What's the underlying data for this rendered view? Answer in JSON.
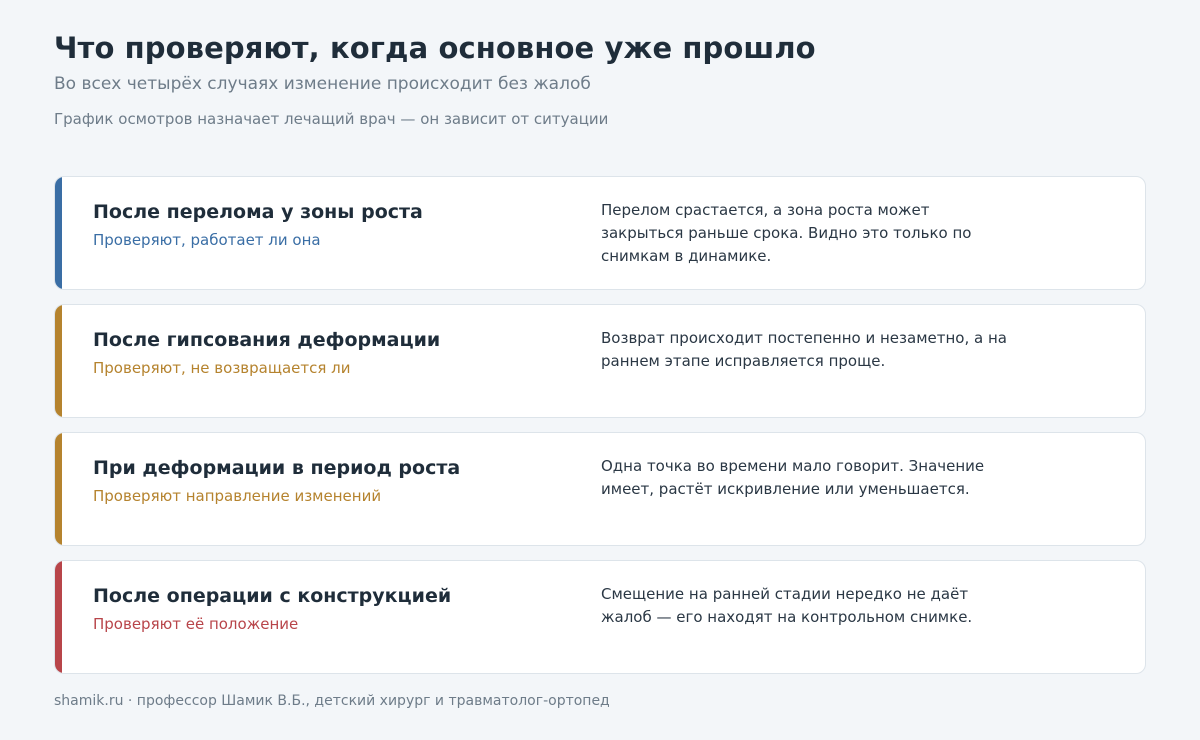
{
  "header": {
    "title": "Что проверяют, когда основное уже прошло",
    "subtitle": "Во всех четырёх случаях изменение происходит без жалоб",
    "note": "График осмотров назначает лечащий врач — он зависит от ситуации"
  },
  "colors": {
    "blue": "#3a6ea5",
    "amber": "#b5832e",
    "red": "#b8454a"
  },
  "cards": [
    {
      "heading": "После перелома у зоны роста",
      "sub": "Проверяют, работает ли она",
      "desc": "Перелом срастается, а зона роста может закрыться раньше срока. Видно это только по снимкам в динамике.",
      "accent": "#3a6ea5"
    },
    {
      "heading": "После гипсования деформации",
      "sub": "Проверяют, не возвращается ли",
      "desc": "Возврат происходит постепенно и незаметно, а на раннем этапе исправляется проще.",
      "accent": "#b5832e"
    },
    {
      "heading": "При деформации в период роста",
      "sub": "Проверяют направление изменений",
      "desc": "Одна точка во времени мало говорит. Значение имеет, растёт искривление или уменьшается.",
      "accent": "#b5832e"
    },
    {
      "heading": "После операции с конструкцией",
      "sub": "Проверяют её положение",
      "desc": "Смещение на ранней стадии нередко не даёт жалоб — его находят на контрольном снимке.",
      "accent": "#b8454a"
    }
  ],
  "footer": {
    "text": "shamik.ru · профессор Шамик В.Б., детский хирург и травматолог-ортопед"
  }
}
